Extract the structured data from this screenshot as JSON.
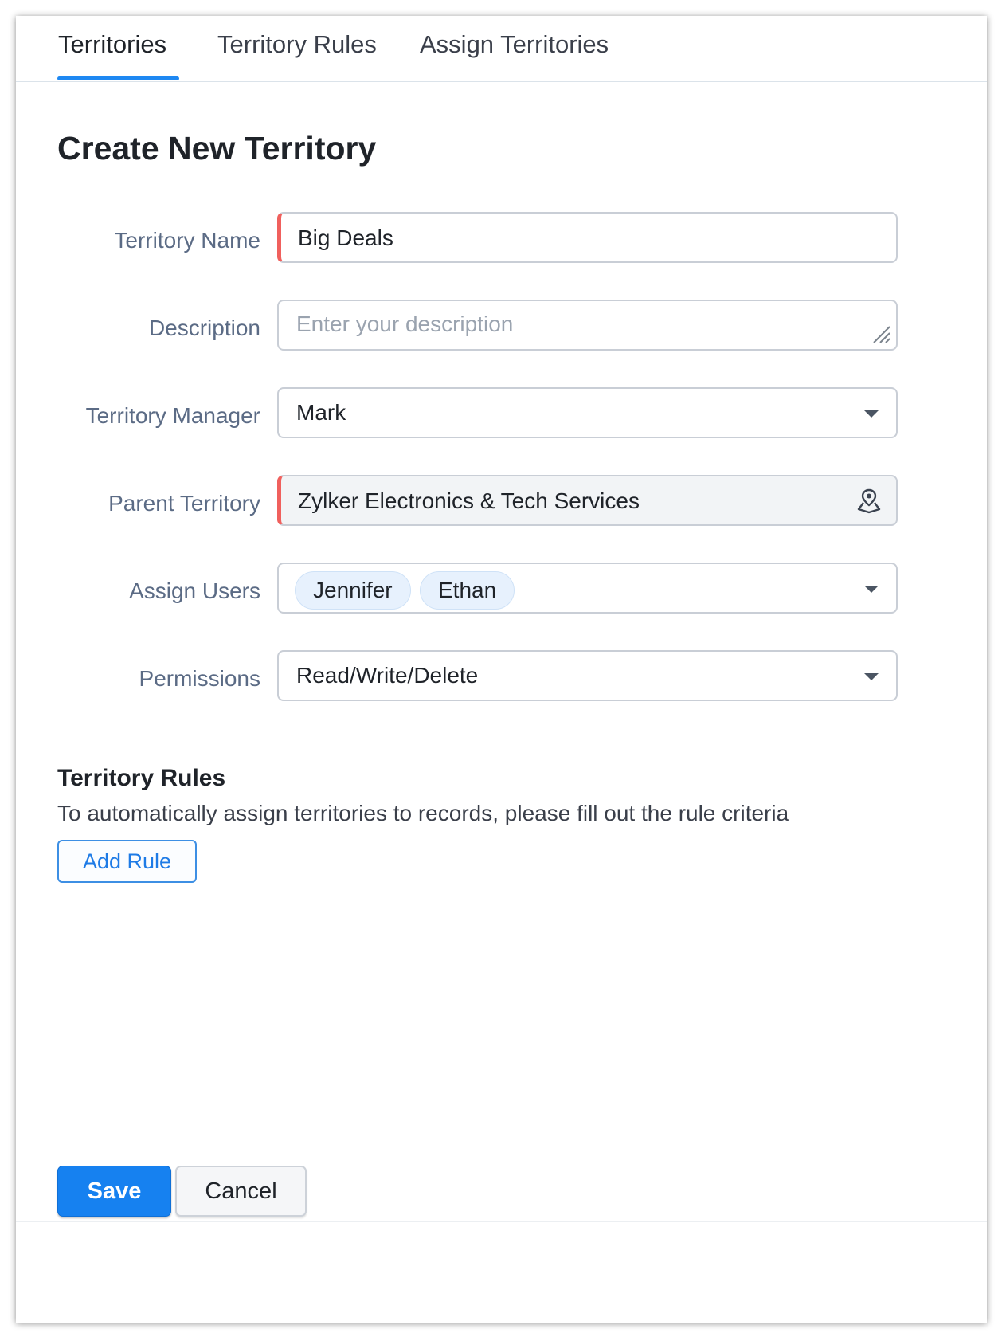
{
  "tabs": [
    {
      "label": "Territories",
      "active": true
    },
    {
      "label": "Territory Rules",
      "active": false
    },
    {
      "label": "Assign Territories",
      "active": false
    }
  ],
  "page_title": "Create New Territory",
  "form": {
    "territory_name": {
      "label": "Territory Name",
      "value": "Big Deals",
      "mandatory": true
    },
    "description": {
      "label": "Description",
      "value": "",
      "placeholder": "Enter your description"
    },
    "territory_manager": {
      "label": "Territory Manager",
      "value": "Mark"
    },
    "parent_territory": {
      "label": "Parent Territory",
      "value": "Zylker Electronics & Tech Services",
      "mandatory": true,
      "icon": "territory-pin-icon"
    },
    "assign_users": {
      "label": "Assign Users",
      "values": [
        "Jennifer",
        "Ethan"
      ]
    },
    "permissions": {
      "label": "Permissions",
      "value": "Read/Write/Delete"
    }
  },
  "rules_section": {
    "title": "Territory Rules",
    "description": "To automatically assign territories to records, please fill out the rule criteria",
    "add_rule_label": "Add Rule"
  },
  "footer": {
    "save_label": "Save",
    "cancel_label": "Cancel"
  },
  "colors": {
    "accent": "#1e88f2",
    "mandatory_marker": "#f0605d",
    "label_text": "#5b6b85",
    "chip_background": "#e7f1fd"
  }
}
